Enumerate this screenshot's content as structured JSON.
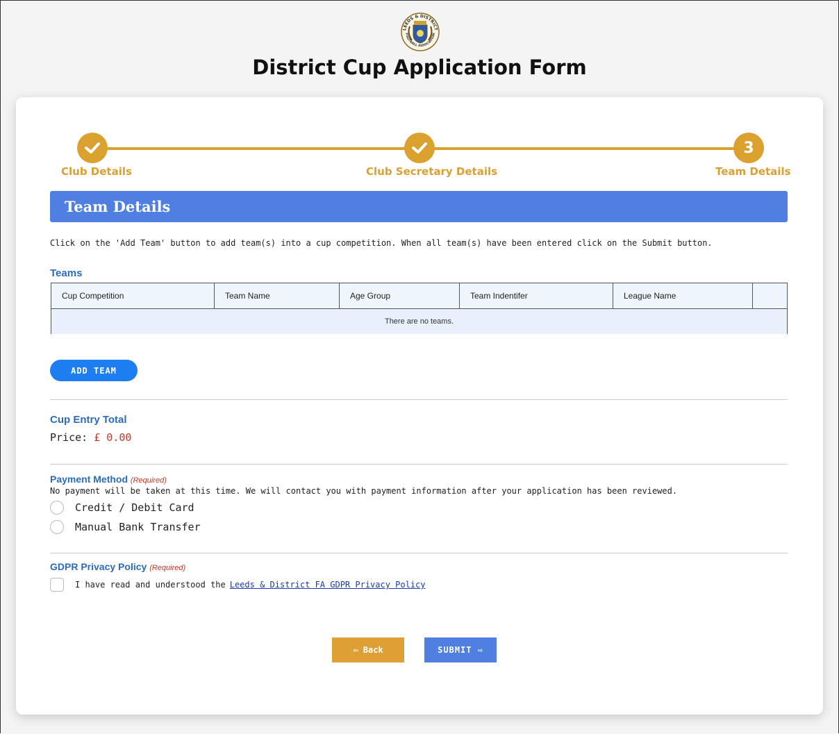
{
  "page": {
    "title": "District Cup Application Form"
  },
  "logo": {
    "top_text": "LEEDS & DISTRICT",
    "bottom_text": "FOOTBALL ASSOCIATION"
  },
  "steps": [
    {
      "label": "Club Details",
      "state": "complete",
      "marker": "✔"
    },
    {
      "label": "Club Secretary Details",
      "state": "complete",
      "marker": "✔"
    },
    {
      "label": "Team Details",
      "state": "current",
      "marker": "3"
    }
  ],
  "section": {
    "header": "Team Details",
    "instructions": "Click on the 'Add Team' button to add team(s) into a cup competition. When all team(s) have been entered click on the Submit button."
  },
  "teams": {
    "label": "Teams",
    "columns": [
      "Cup Competition",
      "Team Name",
      "Age Group",
      "Team Indentifer",
      "League Name",
      ""
    ],
    "empty_message": "There are no teams."
  },
  "add_team_label": "ADD TEAM",
  "cup_entry": {
    "label": "Cup Entry Total",
    "price_label": "Price:",
    "price_value": "£ 0.00"
  },
  "payment": {
    "label": "Payment Method",
    "required": "(Required)",
    "note": "No payment will be taken at this time. We will contact you with payment information after your application has been reviewed.",
    "options": [
      "Credit / Debit Card",
      "Manual Bank Transfer"
    ]
  },
  "gdpr": {
    "label": "GDPR Privacy Policy",
    "required": "(Required)",
    "text": "I have read and understood the",
    "link": "Leeds & District FA GDPR Privacy Policy"
  },
  "buttons": {
    "back": "⇦ Back",
    "submit": "SUBMIT ⇨"
  },
  "colors": {
    "accent_gold": "#dba12f",
    "header_blue": "#4f7fe1",
    "link_blue": "#2c6cb8",
    "required_red": "#c0392b"
  }
}
